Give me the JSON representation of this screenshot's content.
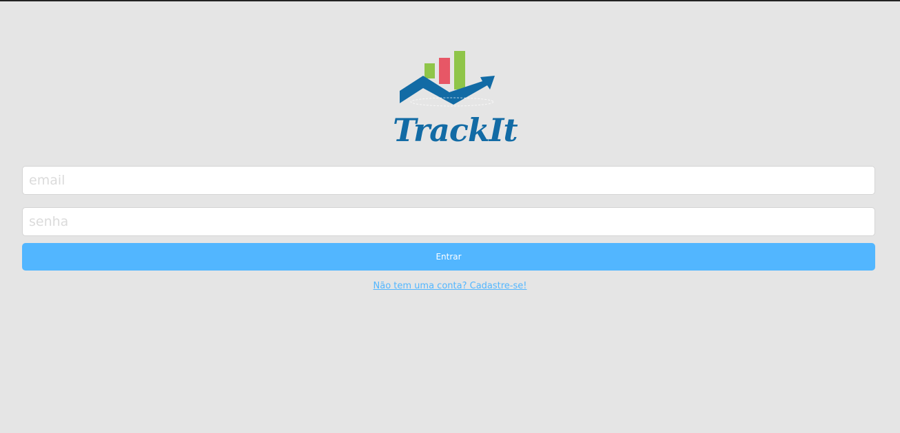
{
  "app": {
    "logo_text": "TrackIt",
    "colors": {
      "brand_blue": "#126ba5",
      "accent_blue": "#52b6ff",
      "bar_green": "#8fc549",
      "bar_red": "#e75766",
      "background": "#e5e5e5"
    }
  },
  "form": {
    "email_placeholder": "email",
    "password_placeholder": "senha",
    "submit_label": "Entrar",
    "signup_link": "Não tem uma conta? Cadastre-se!"
  }
}
